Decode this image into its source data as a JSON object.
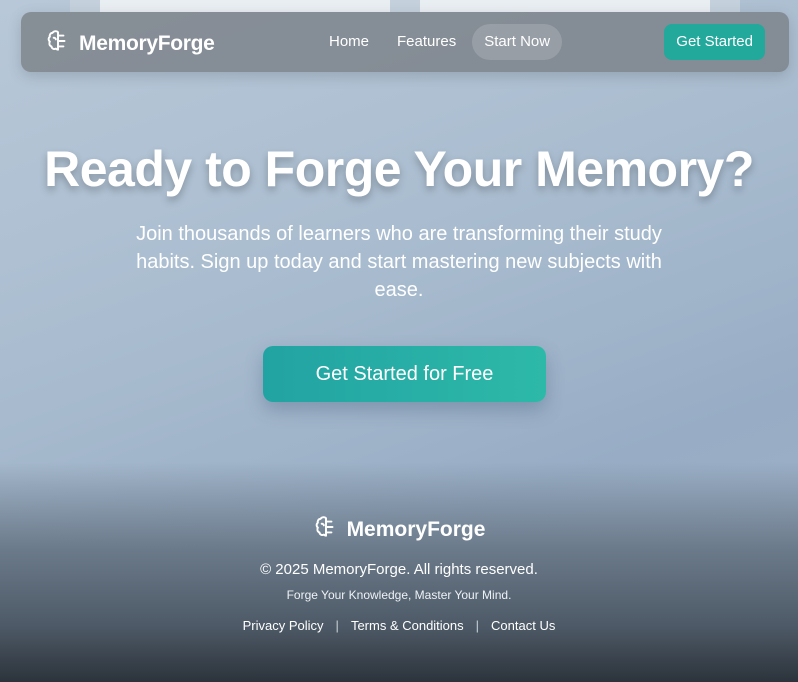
{
  "brand": {
    "name": "MemoryForge",
    "icon": "brain-icon"
  },
  "nav": {
    "links": [
      "Home",
      "Features",
      "Start Now"
    ],
    "active": "Start Now",
    "cta": "Get Started"
  },
  "hero": {
    "title": "Ready to Forge Your Memory?",
    "subtitle": "Join thousands of learners who are transforming their study habits. Sign up today and start mastering new subjects with ease.",
    "button": "Get Started for Free"
  },
  "footer": {
    "brand": "MemoryForge",
    "copyright": "© 2025 MemoryForge. All rights reserved.",
    "tagline": "Forge Your Knowledge, Master Your Mind.",
    "links": [
      "Privacy Policy",
      "Terms & Conditions",
      "Contact Us"
    ],
    "separator": "|"
  },
  "colors": {
    "accent": "#23a89c",
    "nav_bg": "#787e84"
  }
}
